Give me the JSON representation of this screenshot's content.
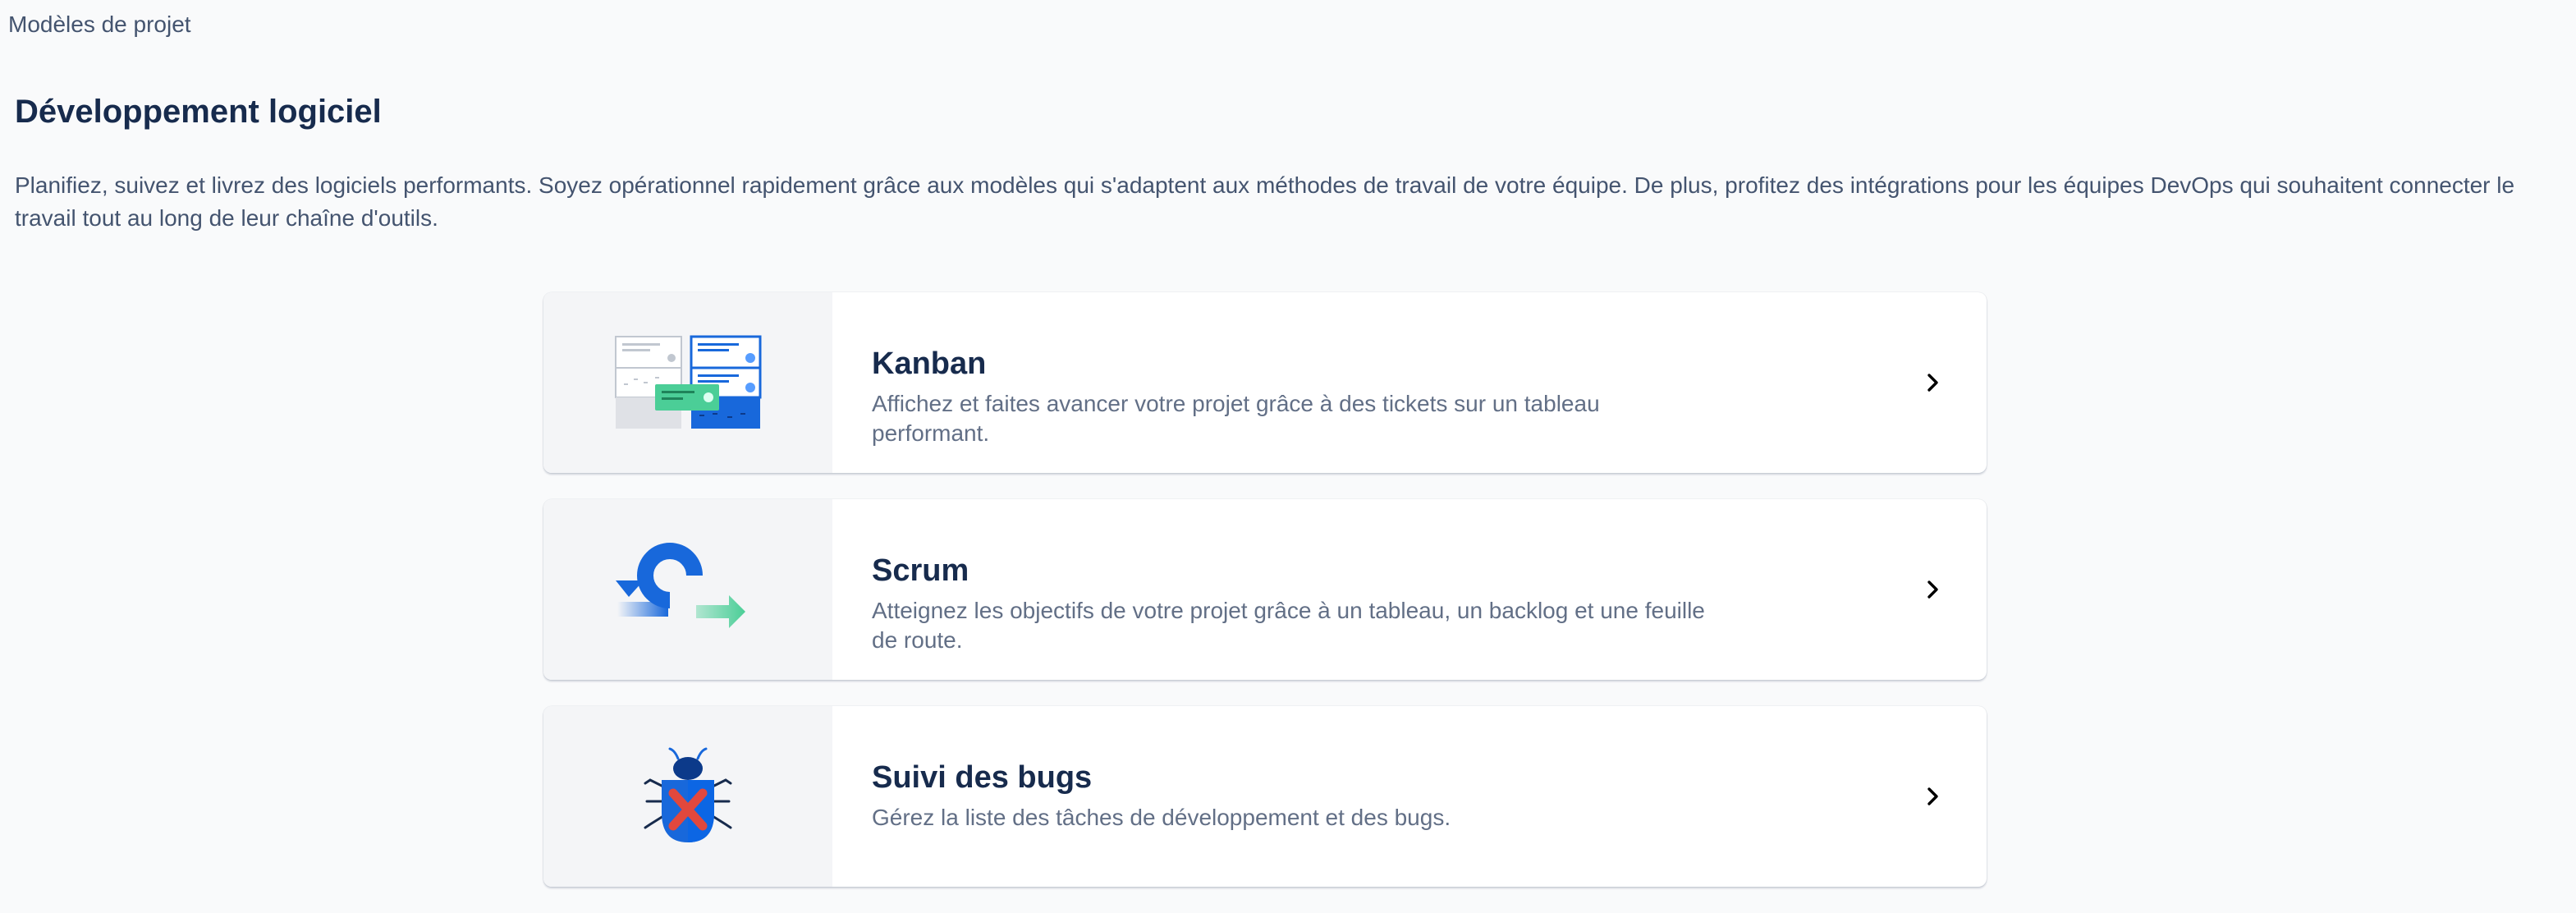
{
  "breadcrumb": "Modèles de projet",
  "section": {
    "title": "Développement logiciel",
    "description": "Planifiez, suivez et livrez des logiciels performants. Soyez opérationnel rapidement grâce aux modèles qui s'adaptent aux méthodes de travail de votre équipe. De plus, profitez des intégrations pour les équipes DevOps qui souhaitent connecter le travail tout au long de leur chaîne d'outils."
  },
  "templates": [
    {
      "title": "Kanban",
      "description": "Affichez et faites avancer votre projet grâce à des tickets sur un tableau performant.",
      "icon": "kanban-board-illustration"
    },
    {
      "title": "Scrum",
      "description": "Atteignez les objectifs de votre projet grâce à un tableau, un backlog et une feuille de route.",
      "icon": "scrum-cycle-illustration"
    },
    {
      "title": "Suivi des bugs",
      "description": "Gérez la liste des tâches de développement et des bugs.",
      "icon": "bug-illustration"
    }
  ],
  "colors": {
    "text_primary": "#172b4d",
    "text_secondary": "#626f86",
    "blue": "#1868db",
    "green": "#4bce97",
    "red": "#e2483d",
    "illustration_bg": "#f4f5f7"
  }
}
